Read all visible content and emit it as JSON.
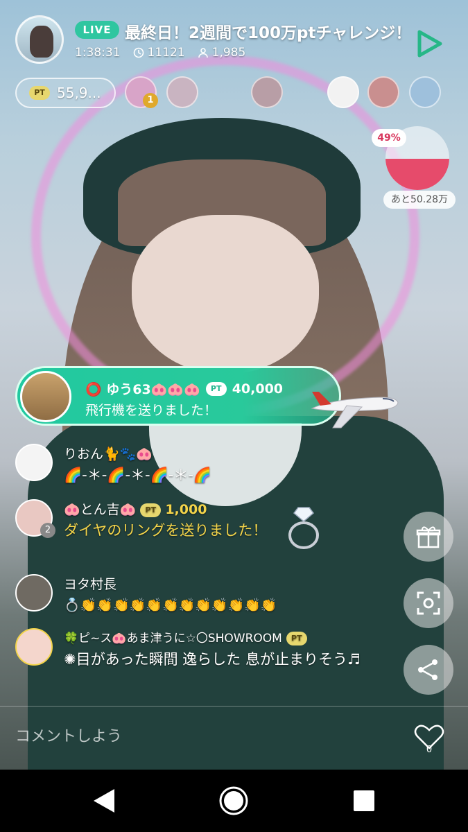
{
  "header": {
    "live_label": "LIVE",
    "title": "最終日！2週間で100万ptチャレンジ！",
    "elapsed": "1:38:31",
    "viewers_total": "11121",
    "viewers_now": "1,985"
  },
  "points": {
    "badge": "PT",
    "value": "55,9..."
  },
  "ranking": {
    "top_rank_number": "1"
  },
  "gauge": {
    "percent": "49%",
    "percent_value": 49,
    "remaining": "あと50.28万",
    "fill_color": "#e64b6b"
  },
  "gift_banner": {
    "username": "⭕ ゆう63🐽🐽🐽",
    "pt_badge": "PT",
    "points": "40,000",
    "message": "飛行機を送りました！"
  },
  "comments": [
    {
      "name": "りおん🐈🐾🐽",
      "text": "🌈-＊-🌈-＊-🌈-＊-🌈"
    },
    {
      "name": "🐽とん吉🐽",
      "pt_badge": "PT",
      "points": "1,000",
      "text": "ダイヤのリングを送りました！",
      "avatar_badge": "2"
    },
    {
      "name": "ヨタ村長",
      "text": "💍👏👏👏👏👏👏👏👏👏👏👏👏"
    },
    {
      "name": "🍀ピ~ス🐽あま津うに☆〇SHOWROOM",
      "pt_badge": "PT",
      "text": "✺目があった瞬間 逸らした 息が止まりそう♬"
    }
  ],
  "side_buttons": {
    "gift": "gift-icon",
    "screenshot": "camera-capture-icon",
    "share": "share-icon"
  },
  "comment_bar": {
    "placeholder": "コメントしよう",
    "like_count": "0"
  },
  "navbar": {
    "back": "back-icon",
    "home": "home-icon",
    "recents": "recents-icon"
  },
  "colors": {
    "accent": "#2fc6a0",
    "gift_banner": "#21c9a0",
    "gauge": "#e64b6b",
    "gift_text": "#f3d44a"
  }
}
